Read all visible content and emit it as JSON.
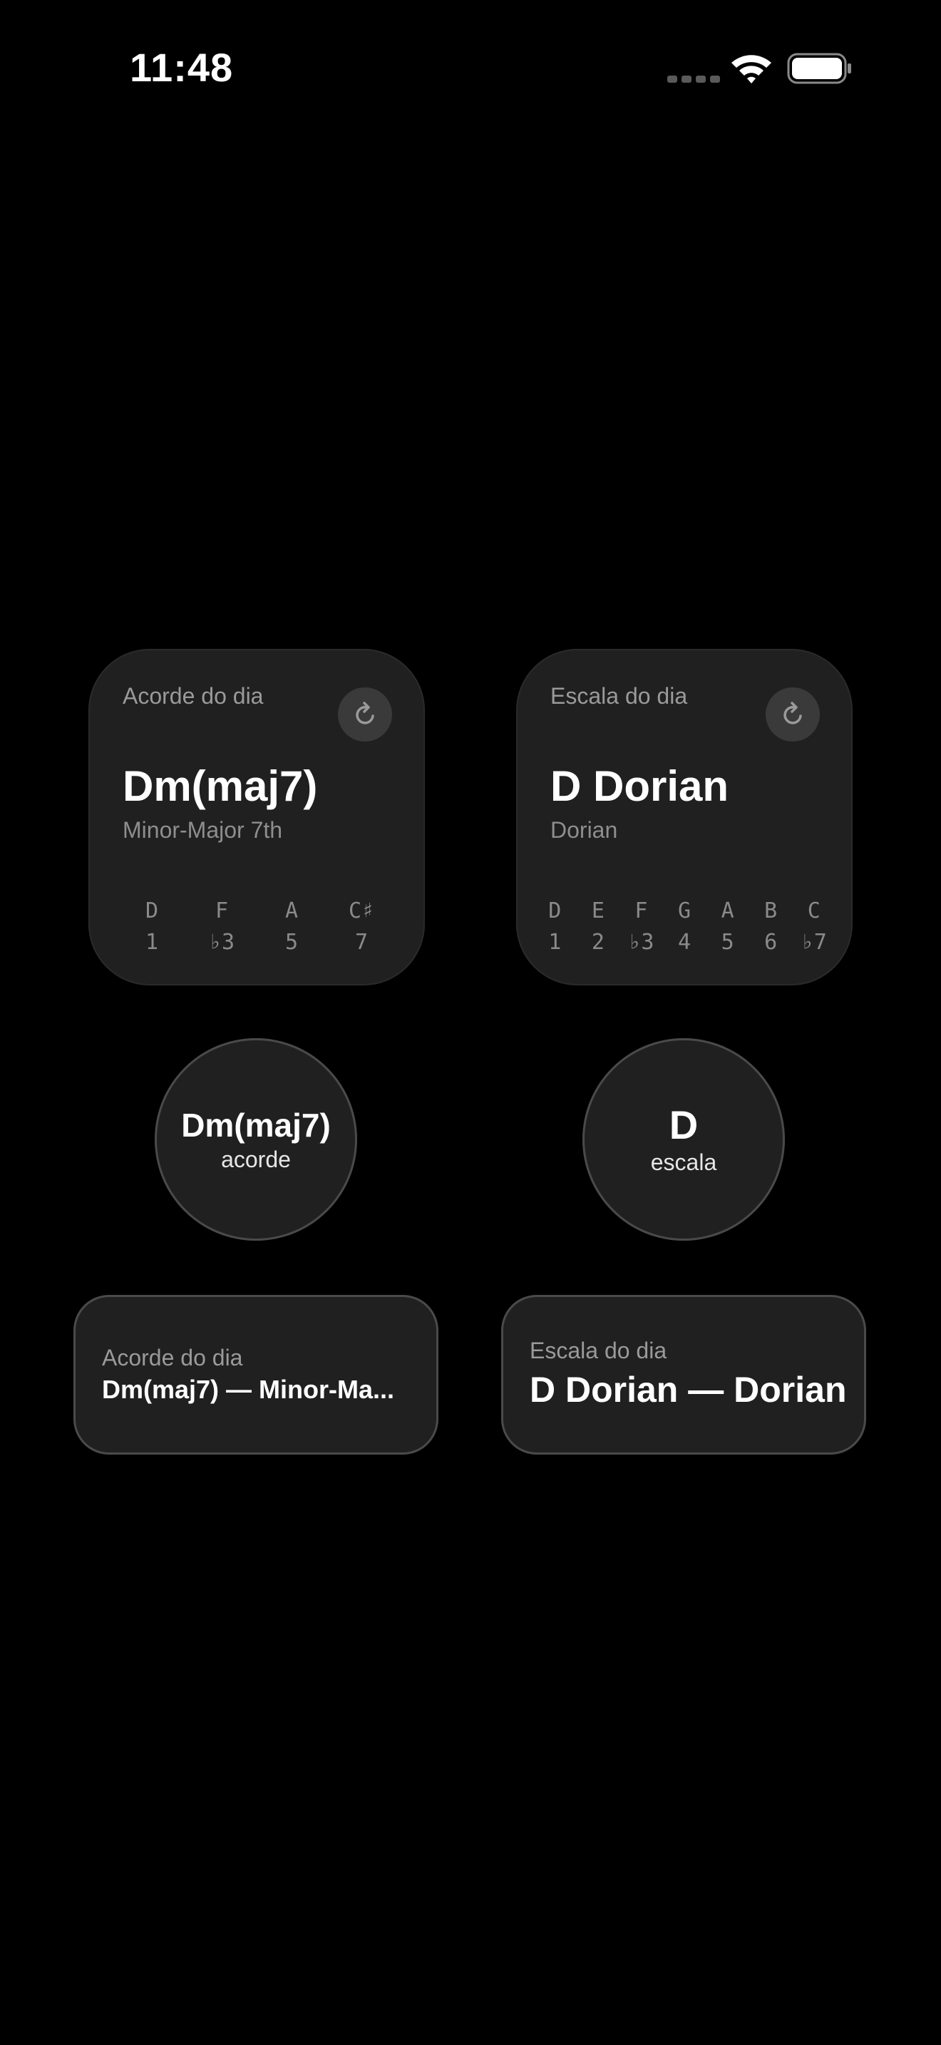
{
  "status_bar": {
    "time": "11:48",
    "icons": [
      "signal-icon",
      "wifi-icon",
      "battery-icon"
    ]
  },
  "chord_widget": {
    "label": "Acorde do dia",
    "refresh_icon": "refresh-icon",
    "title": "Dm(maj7)",
    "subtitle": "Minor-Major 7th",
    "notes": [
      {
        "note": "D",
        "degree": "1"
      },
      {
        "note": "F",
        "degree": "♭3"
      },
      {
        "note": "A",
        "degree": "5"
      },
      {
        "note": "C♯",
        "degree": "7"
      }
    ]
  },
  "scale_widget": {
    "label": "Escala do dia",
    "refresh_icon": "refresh-icon",
    "title": "D Dorian",
    "subtitle": "Dorian",
    "notes": [
      {
        "note": "D",
        "degree": "1"
      },
      {
        "note": "E",
        "degree": "2"
      },
      {
        "note": "F",
        "degree": "♭3"
      },
      {
        "note": "G",
        "degree": "4"
      },
      {
        "note": "A",
        "degree": "5"
      },
      {
        "note": "B",
        "degree": "6"
      },
      {
        "note": "C",
        "degree": "♭7"
      }
    ]
  },
  "chord_circle": {
    "title": "Dm(maj7)",
    "subtitle": "acorde"
  },
  "scale_circle": {
    "title": "D",
    "subtitle": "escala"
  },
  "chord_rect": {
    "label": "Acorde do dia",
    "text": "Dm(maj7) — Minor-Ma..."
  },
  "scale_rect": {
    "label": "Escala do dia",
    "text": "D Dorian — Dorian"
  },
  "colors": {
    "background": "#000000",
    "widget": "#202020",
    "secondary_text": "#9a9a9a"
  }
}
